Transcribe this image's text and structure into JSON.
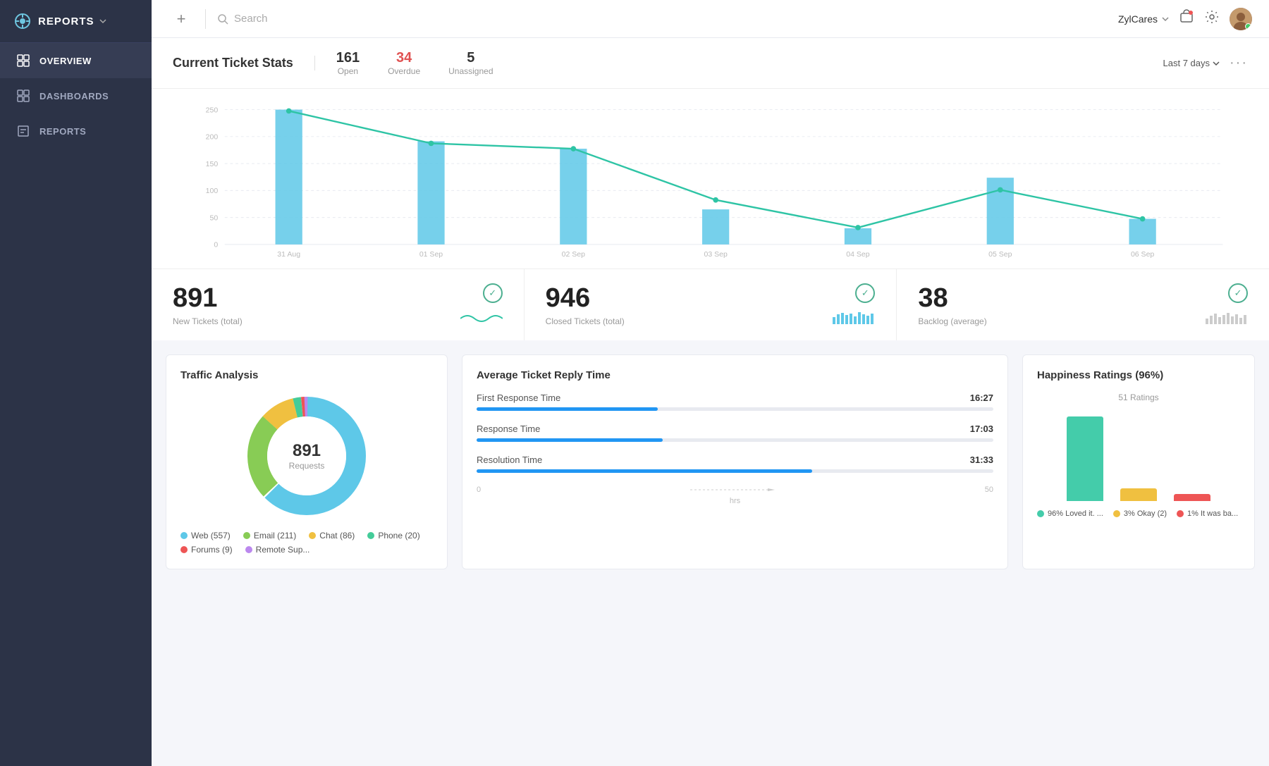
{
  "sidebar": {
    "logo_label": "REPORTS",
    "items": [
      {
        "id": "overview",
        "label": "OVERVIEW",
        "active": true
      },
      {
        "id": "dashboards",
        "label": "DASHBOARDS",
        "active": false
      },
      {
        "id": "reports",
        "label": "REPORTS",
        "active": false
      }
    ]
  },
  "topbar": {
    "search_placeholder": "Search",
    "user_name": "ZylCares",
    "period": "Last 7 days"
  },
  "ticket_stats": {
    "title": "Current Ticket Stats",
    "stats": [
      {
        "value": "161",
        "label": "Open",
        "overdue": false
      },
      {
        "value": "34",
        "label": "Overdue",
        "overdue": true
      },
      {
        "value": "5",
        "label": "Unassigned",
        "overdue": false
      }
    ]
  },
  "chart": {
    "y_labels": [
      "250",
      "200",
      "150",
      "100",
      "50",
      "0"
    ],
    "x_labels": [
      "31 Aug",
      "01 Sep",
      "02 Sep",
      "03 Sep",
      "04 Sep",
      "05 Sep",
      "06 Sep"
    ],
    "bars": [
      260,
      195,
      183,
      84,
      30,
      128,
      48
    ],
    "line": [
      255,
      193,
      187,
      86,
      32,
      105,
      50
    ]
  },
  "kpis": [
    {
      "value": "891",
      "label": "New Tickets (total)",
      "check_color": "#4caf90"
    },
    {
      "value": "946",
      "label": "Closed Tickets (total)",
      "check_color": "#4caf90"
    },
    {
      "value": "38",
      "label": "Backlog (average)",
      "check_color": "#4caf90"
    }
  ],
  "traffic": {
    "title": "Traffic Analysis",
    "total": "891",
    "sub": "Requests",
    "donut_segments": [
      {
        "label": "Web",
        "count": 557,
        "color": "#5ec8e8",
        "percent": 62.5
      },
      {
        "label": "Email",
        "count": 211,
        "color": "#88cc55",
        "percent": 23.7
      },
      {
        "label": "Chat",
        "count": 86,
        "color": "#f0c040",
        "percent": 9.6
      },
      {
        "label": "Phone",
        "count": 20,
        "color": "#44cc99",
        "percent": 2.2
      },
      {
        "label": "Forums",
        "count": 9,
        "color": "#ee5555",
        "percent": 1.0
      },
      {
        "label": "Remote Sup...",
        "count": 8,
        "color": "#bb88ee",
        "percent": 0.9
      }
    ]
  },
  "reply_time": {
    "title": "Average Ticket Reply Time",
    "rows": [
      {
        "label": "First Response Time",
        "time": "16:27",
        "bar_pct": 35
      },
      {
        "label": "Response Time",
        "time": "17:03",
        "bar_pct": 36
      },
      {
        "label": "Resolution Time",
        "time": "31:33",
        "bar_pct": 65
      }
    ],
    "axis_start": "0",
    "axis_end": "50",
    "axis_unit": "hrs"
  },
  "happiness": {
    "title": "Happiness Ratings (96%)",
    "subtitle": "51 Ratings",
    "bars": [
      {
        "label": "96% Loved it. ...",
        "color": "#44ccaa",
        "height": 120
      },
      {
        "label": "3% Okay (2)",
        "color": "#f0c040",
        "height": 18
      },
      {
        "label": "1% It was ba...",
        "color": "#ee5555",
        "height": 10
      }
    ]
  }
}
